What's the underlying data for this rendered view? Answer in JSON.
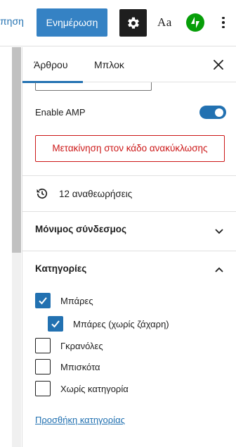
{
  "toolbar": {
    "partial_link_label": "πηση",
    "update_button_label": "Ενημέρωση",
    "typography_label": "Aa",
    "settings_active": true
  },
  "sidebar": {
    "tabs": [
      {
        "label": "Άρθρου",
        "active": true
      },
      {
        "label": "Μπλοκ",
        "active": false
      }
    ],
    "amp": {
      "label": "Enable AMP",
      "enabled": true
    },
    "trash_button_label": "Μετακίνηση στον κάδο ανακύκλωσης",
    "revisions_label": "12 αναθεωρήσεις",
    "permalink_panel": {
      "title": "Μόνιμος σύνδεσμος",
      "expanded": false
    },
    "categories_panel": {
      "title": "Κατηγορίες",
      "expanded": true,
      "items": [
        {
          "label": "Μπάρες",
          "checked": true,
          "level": 0
        },
        {
          "label": "Μπάρες (χωρίς ζάχαρη)",
          "checked": true,
          "level": 1
        },
        {
          "label": "Γκρανόλες",
          "checked": false,
          "level": 0
        },
        {
          "label": "Μπισκότα",
          "checked": false,
          "level": 0
        },
        {
          "label": "Χωρίς κατηγορία",
          "checked": false,
          "level": 0
        }
      ],
      "add_link_label": "Προσθήκη κατηγορίας"
    }
  },
  "colors": {
    "accent": "#2271b1",
    "update_button": "#3582c4",
    "danger": "#cc1818",
    "jetpack": "#069e08"
  }
}
